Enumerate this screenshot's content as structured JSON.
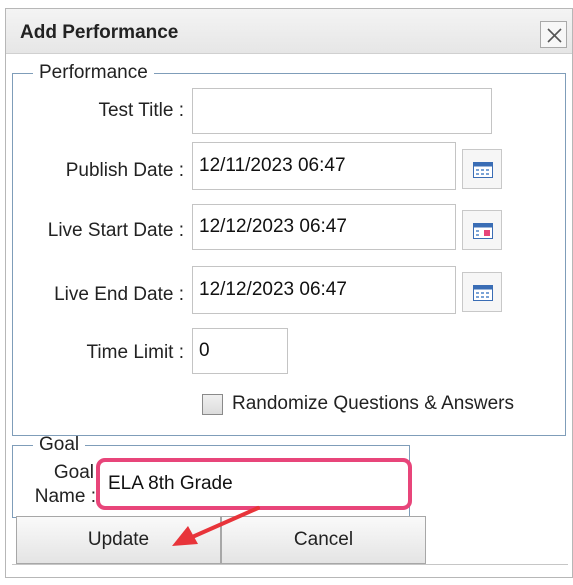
{
  "dialog": {
    "title": "Add Performance",
    "close_symbol": "×"
  },
  "performance": {
    "legend": "Performance",
    "test_title": {
      "label": "Test Title :",
      "value": ""
    },
    "publish_date": {
      "label": "Publish Date :",
      "value": "12/11/2023 06:47"
    },
    "live_start_date": {
      "label": "Live Start Date :",
      "value": "12/12/2023 06:47"
    },
    "live_end_date": {
      "label": "Live End Date :",
      "value": "12/12/2023 06:47"
    },
    "time_limit": {
      "label": "Time Limit :",
      "value": "0"
    },
    "randomize": {
      "label": "Randomize Questions & Answers",
      "checked": false
    }
  },
  "goal": {
    "legend": "Goal",
    "name_label_line1": "Goal",
    "name_label_line2": "Name :",
    "name_value": "ELA 8th Grade"
  },
  "buttons": {
    "update": "Update",
    "cancel": "Cancel"
  },
  "icons": {
    "close": "close-icon",
    "calendar": "calendar-icon",
    "annotation_arrow": "red-arrow-icon"
  },
  "colors": {
    "highlight": "#e8457a",
    "arrow": "#e8343a",
    "fieldset_border": "#7f9db9"
  }
}
